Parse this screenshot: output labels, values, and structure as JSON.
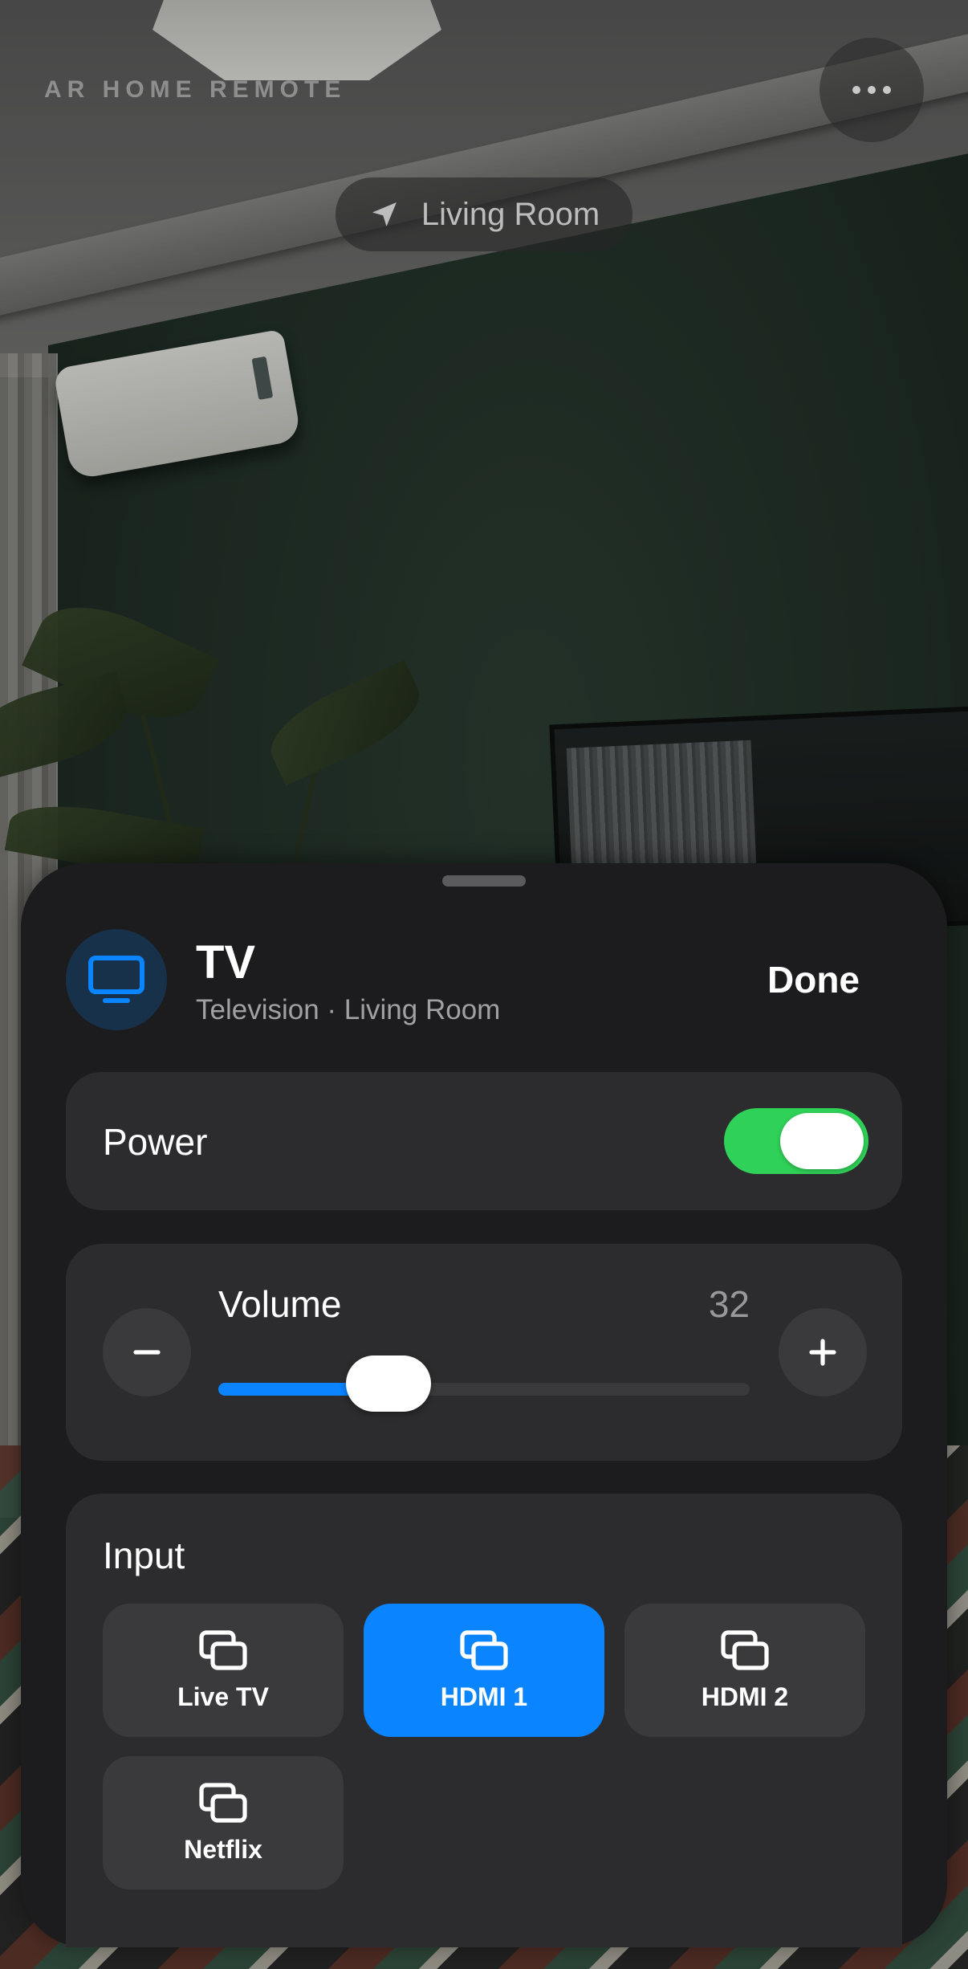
{
  "header": {
    "app_title": "AR HOME REMOTE",
    "more_icon": "ellipsis-icon",
    "location_icon": "location-arrow-icon",
    "location_label": "Living Room"
  },
  "device": {
    "icon": "tv-icon",
    "name": "TV",
    "subtitle": "Television · Living Room",
    "done_label": "Done",
    "accent_color": "#0a84ff"
  },
  "power": {
    "label": "Power",
    "on": true,
    "toggle_color": "#30d158"
  },
  "volume": {
    "label": "Volume",
    "value": "32",
    "level_fraction": 0.32,
    "decrease_icon": "minus-icon",
    "increase_icon": "plus-icon"
  },
  "input": {
    "label": "Input",
    "options": [
      {
        "label": "Live TV",
        "icon": "input-source-icon",
        "selected": false
      },
      {
        "label": "HDMI 1",
        "icon": "input-source-icon",
        "selected": true
      },
      {
        "label": "HDMI 2",
        "icon": "input-source-icon",
        "selected": false
      },
      {
        "label": "Netflix",
        "icon": "input-source-icon",
        "selected": false
      }
    ]
  }
}
